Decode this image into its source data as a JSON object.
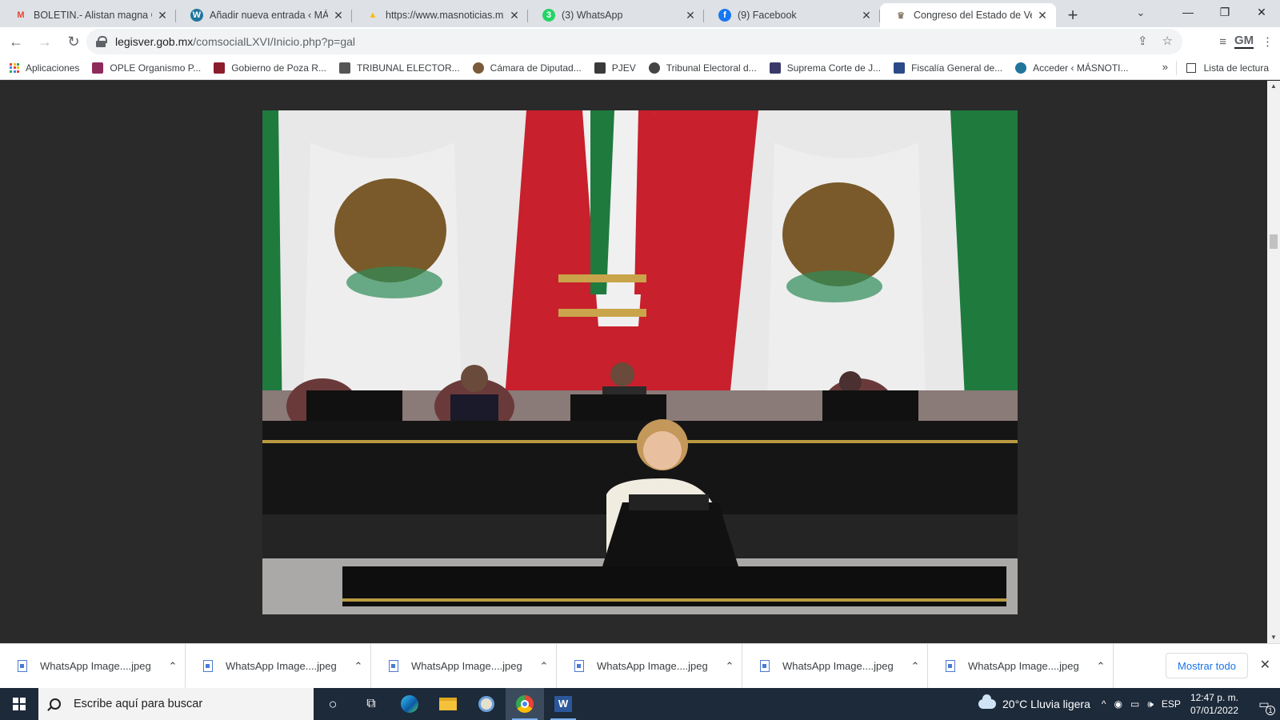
{
  "tabs": [
    {
      "title": "BOLETIN.- Alistan magna Gala",
      "favicon": "gmail-icon",
      "active": false
    },
    {
      "title": "Añadir nueva entrada ‹ MÁSN",
      "favicon": "wordpress-icon",
      "active": false
    },
    {
      "title": "https://www.masnoticias.mx",
      "favicon": "drive-icon",
      "active": false
    },
    {
      "title": "(3) WhatsApp",
      "favicon": "whatsapp-icon",
      "active": false
    },
    {
      "title": "(9) Facebook",
      "favicon": "facebook-icon",
      "active": false
    },
    {
      "title": "Congreso del Estado de Vera",
      "favicon": "congreso-icon",
      "active": true
    }
  ],
  "toolbar": {
    "url_host": "legisver.gob.mx",
    "url_path": "/comsocialLXVI/Inicio.php?p=gal",
    "profile_initials": "GM"
  },
  "bookmarks": [
    {
      "label": "Aplicaciones",
      "color": "#ea4335"
    },
    {
      "label": "OPLE Organismo P...",
      "color": "#8e2b5b"
    },
    {
      "label": "Gobierno de Poza R...",
      "color": "#8b1c2c"
    },
    {
      "label": "TRIBUNAL ELECTOR...",
      "color": "#555555"
    },
    {
      "label": "Cámara de Diputad...",
      "color": "#7a5a3a"
    },
    {
      "label": "PJEV",
      "color": "#3a3a3a"
    },
    {
      "label": "Tribunal Electoral d...",
      "color": "#444444"
    },
    {
      "label": "Suprema Corte de J...",
      "color": "#3a3a6a"
    },
    {
      "label": "Fiscalía General de...",
      "color": "#2a4a8a"
    },
    {
      "label": "Acceder ‹ MÁSNOTI...",
      "color": "#21759b"
    }
  ],
  "reading_list": "Lista de lectura",
  "downloads": [
    {
      "name": "WhatsApp Image....jpeg"
    },
    {
      "name": "WhatsApp Image....jpeg"
    },
    {
      "name": "WhatsApp Image....jpeg"
    },
    {
      "name": "WhatsApp Image....jpeg"
    },
    {
      "name": "WhatsApp Image....jpeg"
    },
    {
      "name": "WhatsApp Image....jpeg"
    }
  ],
  "show_all": "Mostrar todo",
  "taskbar": {
    "search_placeholder": "Escribe aquí para buscar",
    "weather": "20°C  Lluvia ligera",
    "lang": "ESP",
    "time": "12:47 p. m.",
    "date": "07/01/2022",
    "notifications": "1"
  }
}
